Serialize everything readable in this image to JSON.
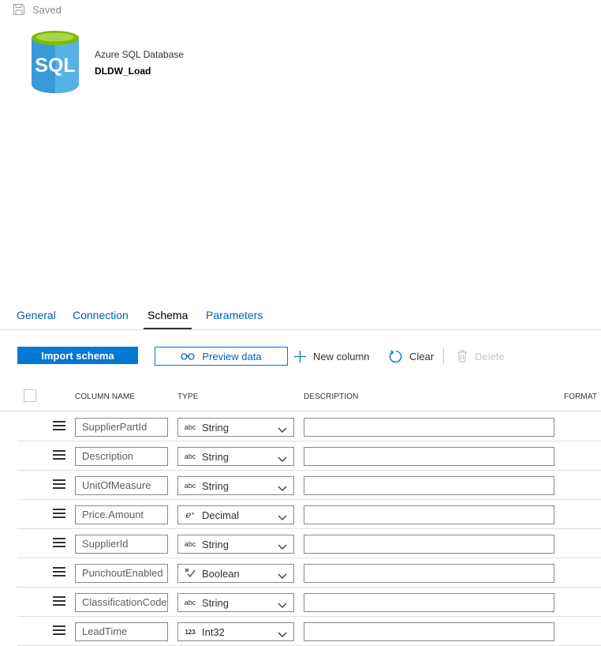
{
  "status": {
    "saved_label": "Saved",
    "icon": "save-icon"
  },
  "dataset": {
    "icon": "sql-database-icon",
    "icon_text": "SQL",
    "type": "Azure SQL Database",
    "name": "DLDW_Load"
  },
  "tabs": [
    {
      "label": "General",
      "active": false
    },
    {
      "label": "Connection",
      "active": false
    },
    {
      "label": "Schema",
      "active": true
    },
    {
      "label": "Parameters",
      "active": false
    }
  ],
  "toolbar": {
    "import_label": "Import schema",
    "preview_label": "Preview data",
    "new_column_label": "New column",
    "clear_label": "Clear",
    "delete_label": "Delete"
  },
  "grid": {
    "columns": {
      "name": "COLUMN NAME",
      "type": "TYPE",
      "description": "DESCRIPTION",
      "format": "FORMAT"
    },
    "rows": [
      {
        "name": "SupplierPartId",
        "type_icon": "abc",
        "type": "String",
        "description": ""
      },
      {
        "name": "Description",
        "type_icon": "abc",
        "type": "String",
        "description": ""
      },
      {
        "name": "UnitOfMeasure",
        "type_icon": "abc",
        "type": "String",
        "description": ""
      },
      {
        "name": "Price.Amount",
        "type_icon": "eˣ",
        "type": "Decimal",
        "description": ""
      },
      {
        "name": "SupplierId",
        "type_icon": "abc",
        "type": "String",
        "description": ""
      },
      {
        "name": "PunchoutEnabled",
        "type_icon": "boolean-icon",
        "type": "Boolean",
        "description": ""
      },
      {
        "name": "ClassificationCode",
        "type_icon": "abc",
        "type": "String",
        "description": ""
      },
      {
        "name": "LeadTime",
        "type_icon": "123",
        "type": "Int32",
        "description": ""
      }
    ]
  },
  "colors": {
    "accent": "#0078d4",
    "link": "#0062ad",
    "border": "#8a8886",
    "divider": "#e1dfdd"
  }
}
